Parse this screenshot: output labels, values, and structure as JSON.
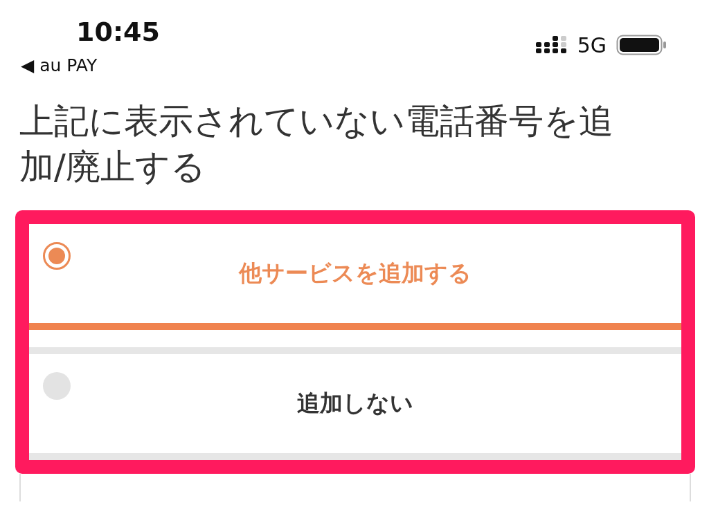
{
  "status_bar": {
    "time": "10:45",
    "back_label": "◀ au PAY",
    "network": "5G"
  },
  "heading": "上記に表示されていない電話番号を追加/廃止する",
  "options": [
    {
      "label": "他サービスを追加する",
      "selected": true
    },
    {
      "label": "追加しない",
      "selected": false
    }
  ]
}
